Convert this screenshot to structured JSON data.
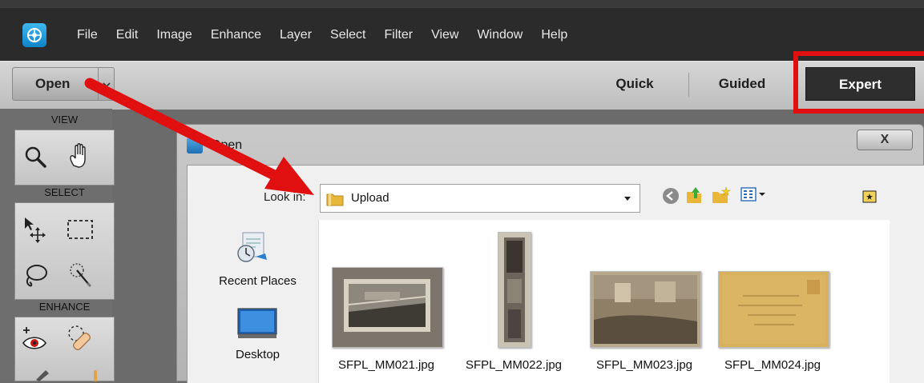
{
  "menu": {
    "items": [
      "File",
      "Edit",
      "Image",
      "Enhance",
      "Layer",
      "Select",
      "Filter",
      "View",
      "Window",
      "Help"
    ]
  },
  "modebar": {
    "open_label": "Open",
    "tabs": {
      "quick": "Quick",
      "guided": "Guided",
      "expert": "Expert"
    },
    "active_tab": "expert"
  },
  "tools": {
    "sections": {
      "view": "VIEW",
      "select": "SELECT",
      "enhance": "ENHANCE"
    }
  },
  "dialog": {
    "title": "Open",
    "close_label": "X",
    "look_in_label": "Look in:",
    "look_in_value": "Upload",
    "places": [
      {
        "label": "Recent Places",
        "icon": "recent-places-icon"
      },
      {
        "label": "Desktop",
        "icon": "desktop-icon"
      }
    ],
    "files": [
      {
        "name": "SFPL_MM021.jpg"
      },
      {
        "name": "SFPL_MM022.jpg"
      },
      {
        "name": "SFPL_MM023.jpg"
      },
      {
        "name": "SFPL_MM024.jpg"
      }
    ]
  },
  "colors": {
    "annotation_red": "#e01010",
    "active_tab_bg": "#2e2e2e",
    "menubar_bg": "#2b2b2b",
    "app_accent": "#1a9be0"
  }
}
